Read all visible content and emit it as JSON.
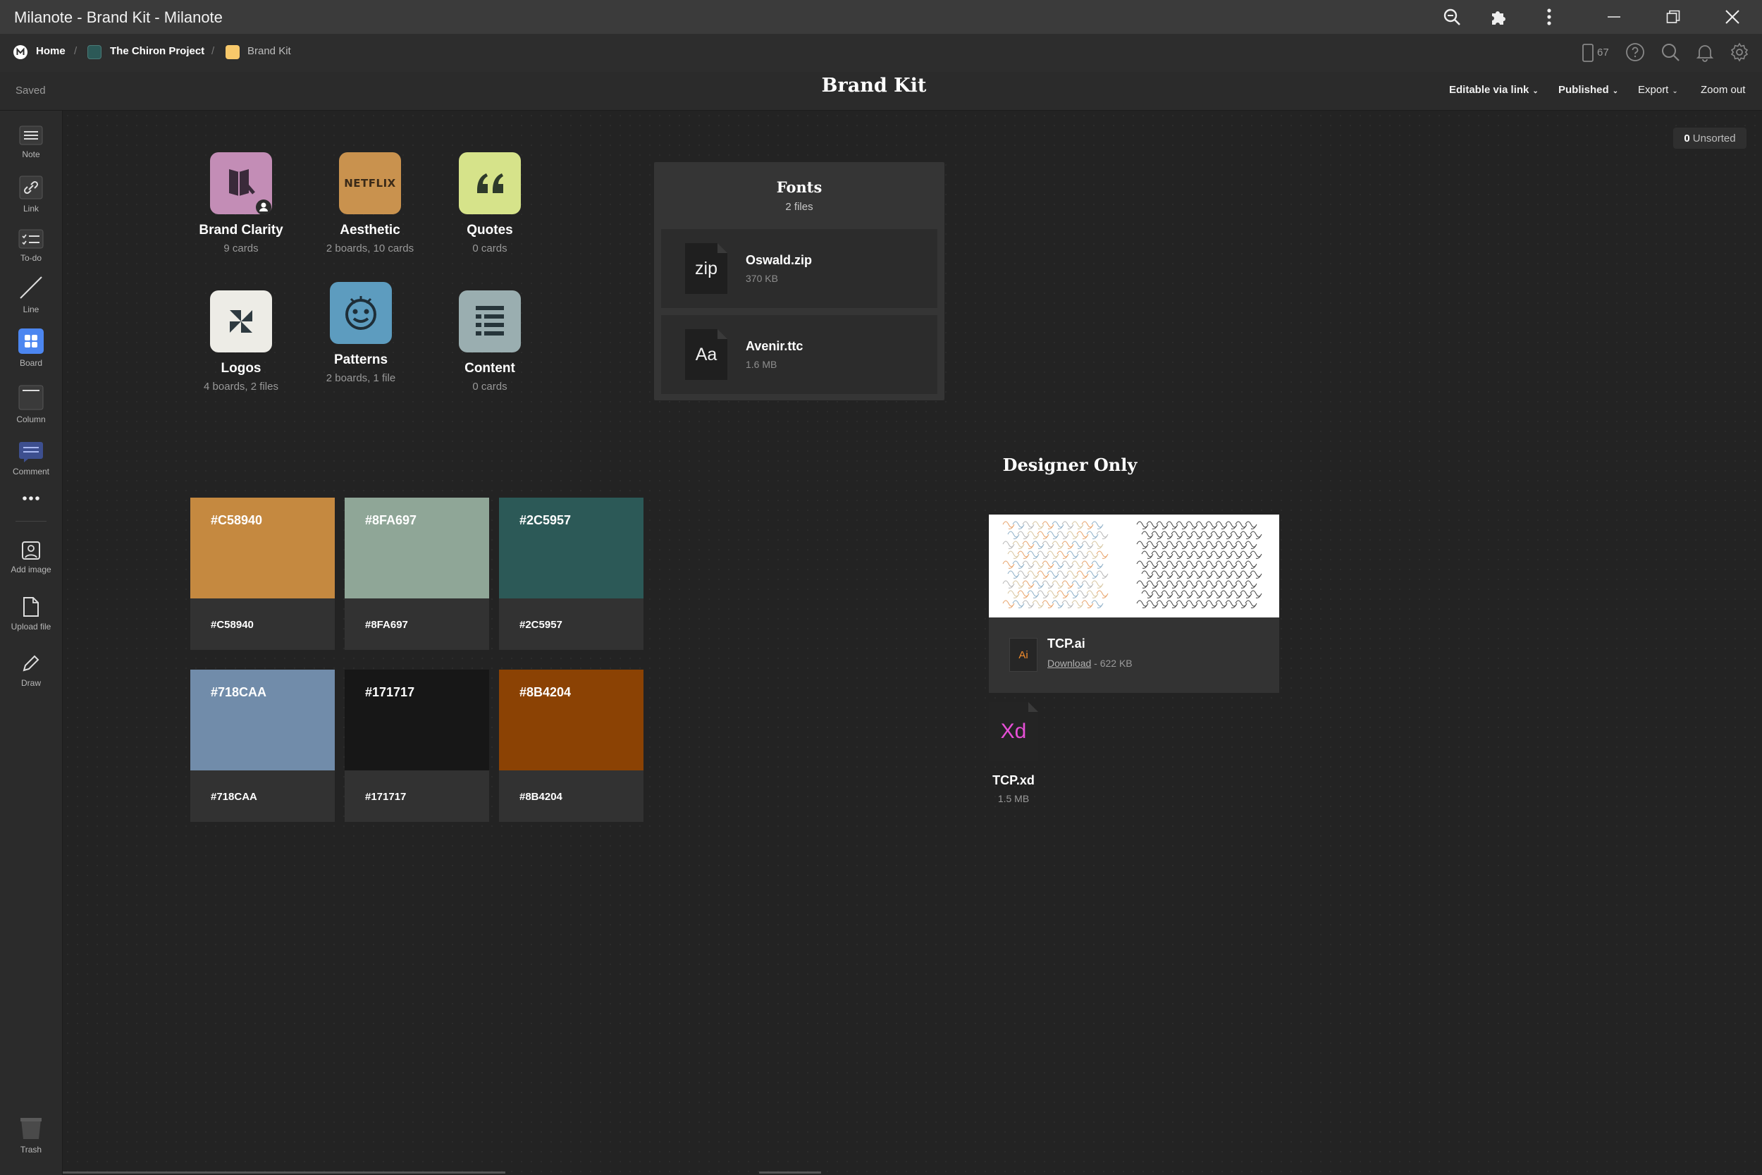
{
  "window": {
    "title": "Milanote - Brand Kit - Milanote"
  },
  "breadcrumb": {
    "home": "Home",
    "project": "The Chiron Project",
    "current": "Brand Kit"
  },
  "nav": {
    "device_count": "67"
  },
  "header": {
    "status": "Saved",
    "title": "Brand Kit",
    "sharing": "Editable via link",
    "published": "Published",
    "export": "Export",
    "zoom": "Zoom out"
  },
  "toolbar": {
    "note": "Note",
    "link": "Link",
    "todo": "To-do",
    "line": "Line",
    "board": "Board",
    "column": "Column",
    "comment": "Comment",
    "add_image": "Add image",
    "upload_file": "Upload file",
    "draw": "Draw",
    "trash": "Trash"
  },
  "unsorted": {
    "count": "0",
    "label": "Unsorted"
  },
  "boards": [
    {
      "name": "Brand Clarity",
      "meta": "9 cards",
      "color": "#C38DB6"
    },
    {
      "name": "Aesthetic",
      "meta": "2 boards, 10 cards",
      "color": "#C9924E",
      "logo_text": "NETFLIX"
    },
    {
      "name": "Quotes",
      "meta": "0 cards",
      "color": "#D6E38A"
    },
    {
      "name": "Logos",
      "meta": "4 boards, 2 files",
      "color": "#EDECE6"
    },
    {
      "name": "Patterns",
      "meta": "2 boards, 1 file",
      "color": "#5D9CBF"
    },
    {
      "name": "Content",
      "meta": "0 cards",
      "color": "#9AAEB0"
    }
  ],
  "fonts": {
    "title": "Fonts",
    "count": "2 files",
    "files": [
      {
        "icon_text": "zip",
        "name": "Oswald.zip",
        "size": "370 KB"
      },
      {
        "icon_text": "Aa",
        "name": "Avenir.ttc",
        "size": "1.6 MB"
      }
    ]
  },
  "swatches": [
    {
      "hex": "#C58940",
      "label": "#C58940"
    },
    {
      "hex": "#8FA697",
      "label": "#8FA697"
    },
    {
      "hex": "#2C5957",
      "label": "#2C5957"
    },
    {
      "hex": "#718CAA",
      "label": "#718CAA"
    },
    {
      "hex": "#171717",
      "label": "#171717"
    },
    {
      "hex": "#8B4204",
      "label": "#8B4204"
    }
  ],
  "designer": {
    "title": "Designer Only",
    "ai_file": {
      "icon_text": "Ai",
      "name": "TCP.ai",
      "link": "Download",
      "size": " - 622 KB"
    },
    "xd_file": {
      "icon_text": "Xd",
      "name": "TCP.xd",
      "size": "1.5 MB"
    }
  }
}
